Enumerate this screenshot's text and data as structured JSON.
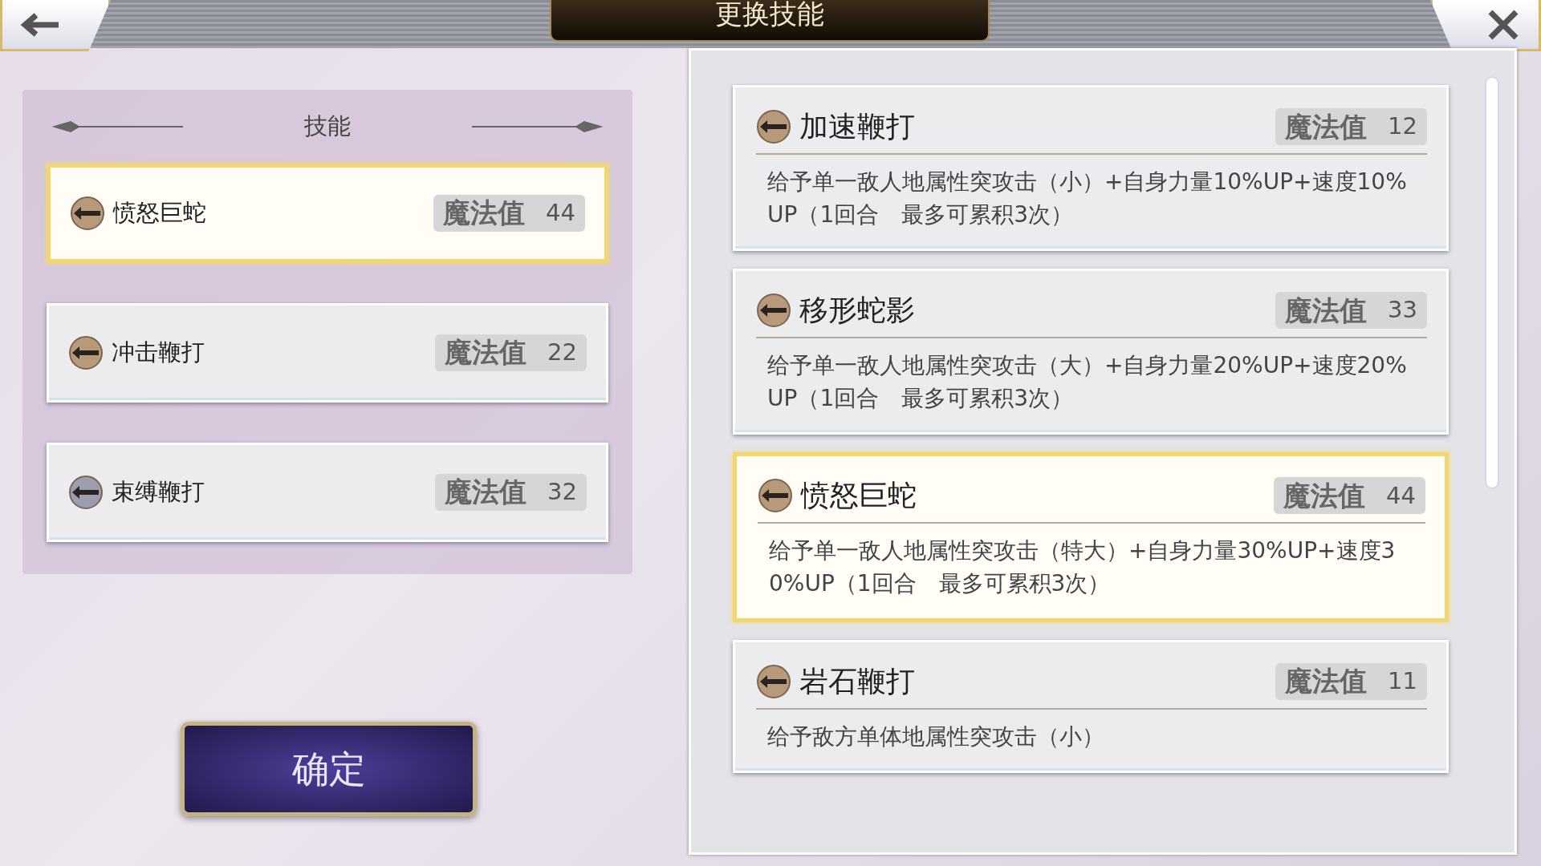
{
  "header": {
    "title": "更换技能"
  },
  "equipped": {
    "title": "技能",
    "skills": [
      {
        "name": "愤怒巨蛇",
        "mp_label": "魔法值",
        "mp": "44",
        "color": "#b89a7a",
        "selected": true
      },
      {
        "name": "冲击鞭打",
        "mp_label": "魔法值",
        "mp": "22",
        "color": "#b89a7a",
        "selected": false
      },
      {
        "name": "束缚鞭打",
        "mp_label": "魔法值",
        "mp": "32",
        "color": "#9a9eae",
        "selected": false
      }
    ]
  },
  "confirm_button": "确定",
  "available": [
    {
      "name": "加速鞭打",
      "mp_label": "魔法值",
      "mp": "12",
      "color": "#b89a7a",
      "selected": false,
      "description": "给予单一敌人地属性突攻击（小）+自身力量10%UP+速度10%UP（1回合　最多可累积3次）"
    },
    {
      "name": "移形蛇影",
      "mp_label": "魔法值",
      "mp": "33",
      "color": "#b89a7a",
      "selected": false,
      "description": "给予单一敌人地属性突攻击（大）+自身力量20%UP+速度20%UP（1回合　最多可累积3次）"
    },
    {
      "name": "愤怒巨蛇",
      "mp_label": "魔法值",
      "mp": "44",
      "color": "#b89a7a",
      "selected": true,
      "description": "给予单一敌人地属性突攻击（特大）+自身力量30%UP+速度30%UP（1回合　最多可累积3次）"
    },
    {
      "name": "岩石鞭打",
      "mp_label": "魔法值",
      "mp": "11",
      "color": "#b89a7a",
      "selected": false,
      "description": "给予敌方单体地属性突攻击（小）"
    }
  ]
}
